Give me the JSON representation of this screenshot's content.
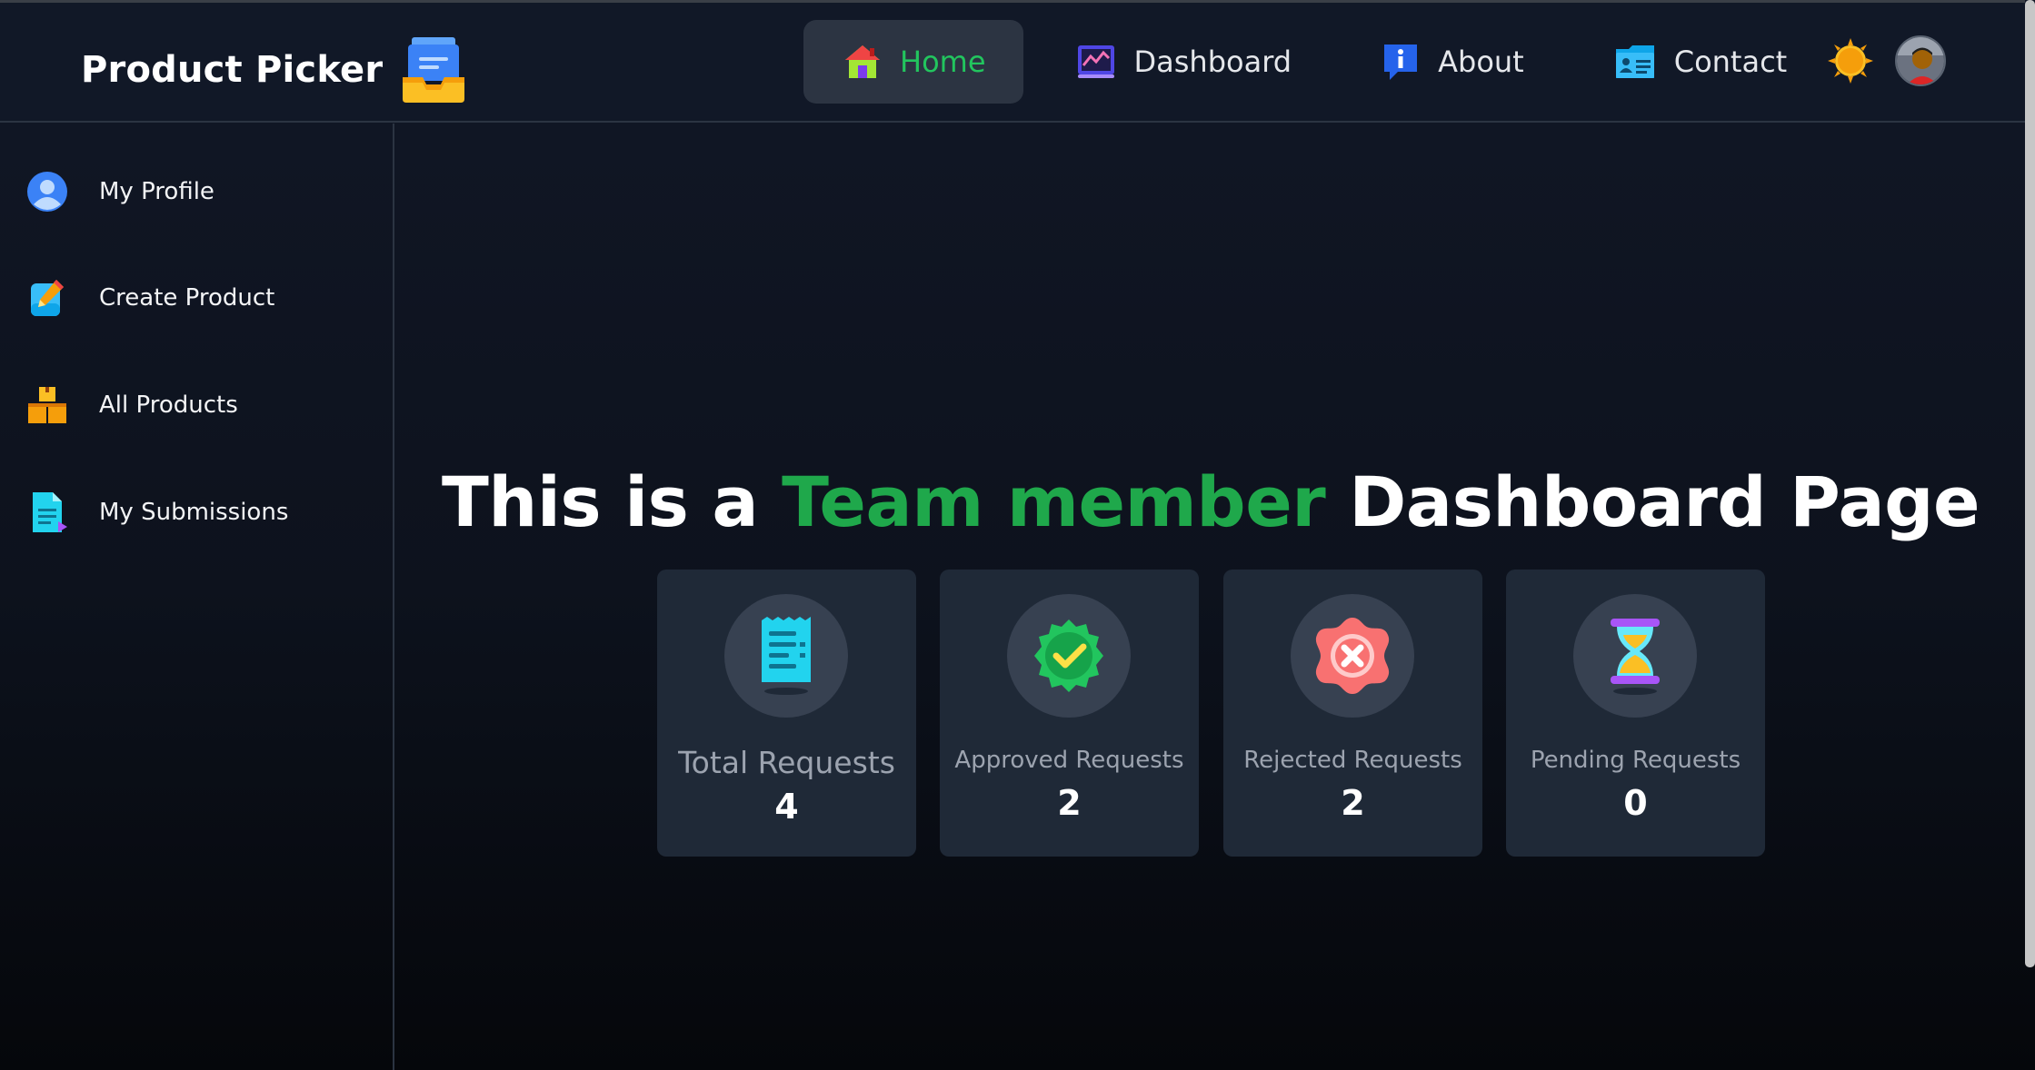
{
  "brand": {
    "title": "Product Picker"
  },
  "nav": {
    "items": [
      {
        "label": "Home",
        "icon": "home-icon",
        "active": true
      },
      {
        "label": "Dashboard",
        "icon": "chart-icon",
        "active": false
      },
      {
        "label": "About",
        "icon": "info-icon",
        "active": false
      },
      {
        "label": "Contact",
        "icon": "contact-card-icon",
        "active": false
      }
    ]
  },
  "sidebar": {
    "items": [
      {
        "label": "My Profile",
        "icon": "user-icon"
      },
      {
        "label": "Create Product",
        "icon": "edit-note-icon"
      },
      {
        "label": "All Products",
        "icon": "boxes-icon"
      },
      {
        "label": "My Submissions",
        "icon": "document-icon"
      }
    ]
  },
  "main": {
    "title_prefix": "This is a",
    "title_highlight": "Team member",
    "title_suffix": "Dashboard Page",
    "cards": [
      {
        "label": "Total Requests",
        "value": "4",
        "icon": "receipt-icon"
      },
      {
        "label": "Approved Requests",
        "value": "2",
        "icon": "check-badge-icon"
      },
      {
        "label": "Rejected Requests",
        "value": "2",
        "icon": "x-badge-icon"
      },
      {
        "label": "Pending Requests",
        "value": "0",
        "icon": "hourglass-icon"
      }
    ]
  },
  "colors": {
    "accent_green": "#22c55e",
    "title_green": "#1fa84b",
    "header_bg": "#111827",
    "card_bg": "#1f2937"
  }
}
